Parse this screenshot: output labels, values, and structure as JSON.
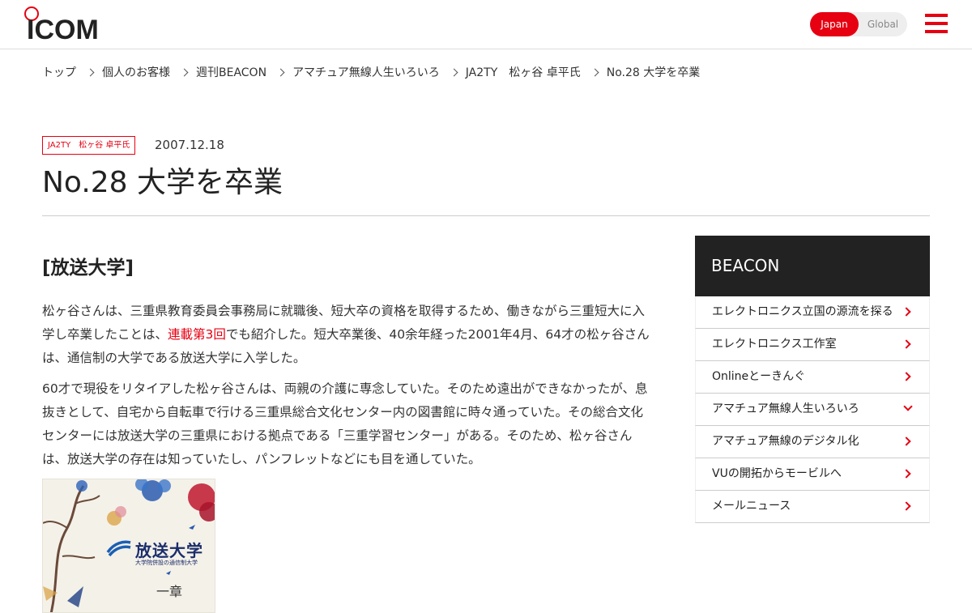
{
  "header": {
    "logo_text": "ICOM",
    "region_japan": "Japan",
    "region_global": "Global"
  },
  "breadcrumb": [
    "トップ",
    "個人のお客様",
    "週刊BEACON",
    "アマチュア無線人生いろいろ",
    "JA2TY　松ヶ谷 卓平氏",
    "No.28 大学を卒業"
  ],
  "article": {
    "tag": "JA2TY　松ヶ谷 卓平氏",
    "date": "2007.12.18",
    "title": "No.28 大学を卒業",
    "section_heading": "[放送大学]",
    "para1_before": "松ヶ谷さんは、三重県教育委員会事務局に就職後、短大卒の資格を取得するため、働きながら三重短大に入学し卒業したことは、",
    "para1_link": "連載第3回",
    "para1_after": "でも紹介した。短大卒業後、40余年経った2001年4月、64才の松ヶ谷さんは、通信制の大学である放送大学に入学した。",
    "para2": "60才で現役をリタイアした松ヶ谷さんは、両親の介護に専念していた。そのため遠出ができなかったが、息抜きとして、自宅から自転車で行ける三重県総合文化センター内の図書館に時々通っていた。その総合文化センターには放送大学の三重県における拠点である「三重学習センター」がある。そのため、松ヶ谷さんは、放送大学の存在は知っていたし、パンフレットなどにも目を通していた。",
    "photo": {
      "brand": "放送大学",
      "brand_sub": "大学院併設の通信制大学",
      "kanji": "一章"
    }
  },
  "sidebar": {
    "heading": "BEACON",
    "items": [
      {
        "label": "エレクトロニクス立国の源流を探る",
        "icon": "chevron-right"
      },
      {
        "label": "エレクトロニクス工作室",
        "icon": "chevron-right"
      },
      {
        "label": "Onlineとーきんぐ",
        "icon": "chevron-right"
      },
      {
        "label": "アマチュア無線人生いろいろ",
        "icon": "chevron-down"
      },
      {
        "label": "アマチュア無線のデジタル化",
        "icon": "chevron-right"
      },
      {
        "label": "VUの開拓からモービルへ",
        "icon": "chevron-right"
      },
      {
        "label": "メールニュース",
        "icon": "chevron-right"
      }
    ]
  },
  "colors": {
    "accent": "#e60012",
    "sidebar_head": "#222222"
  }
}
